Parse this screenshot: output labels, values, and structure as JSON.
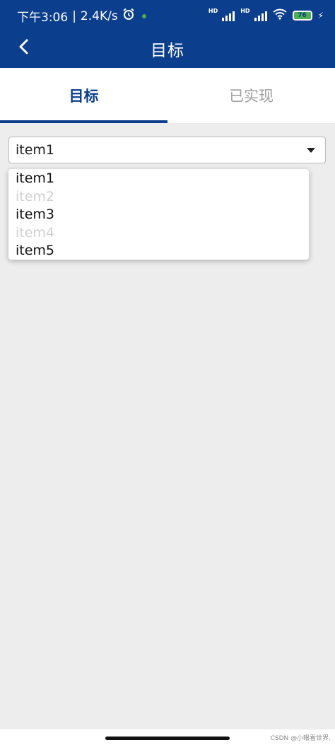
{
  "status_bar": {
    "time": "下午3:06",
    "separator": "|",
    "speed": "2.4K/s",
    "hd1": "HD",
    "hd2": "HD",
    "battery": "76"
  },
  "appbar": {
    "title": "目标"
  },
  "tabs": [
    {
      "label": "目标",
      "active": true
    },
    {
      "label": "已实现",
      "active": false
    }
  ],
  "select": {
    "value": "item1"
  },
  "dropdown": {
    "options": [
      {
        "label": "item1",
        "enabled": true
      },
      {
        "label": "item2",
        "enabled": false
      },
      {
        "label": "item3",
        "enabled": true
      },
      {
        "label": "item4",
        "enabled": false
      },
      {
        "label": "item5",
        "enabled": true
      }
    ]
  },
  "watermark": "CSDN @小眼看世界.",
  "colors": {
    "primary": "#0b3e8c",
    "background": "#ededed",
    "disabled_text": "#d0d0d0"
  }
}
